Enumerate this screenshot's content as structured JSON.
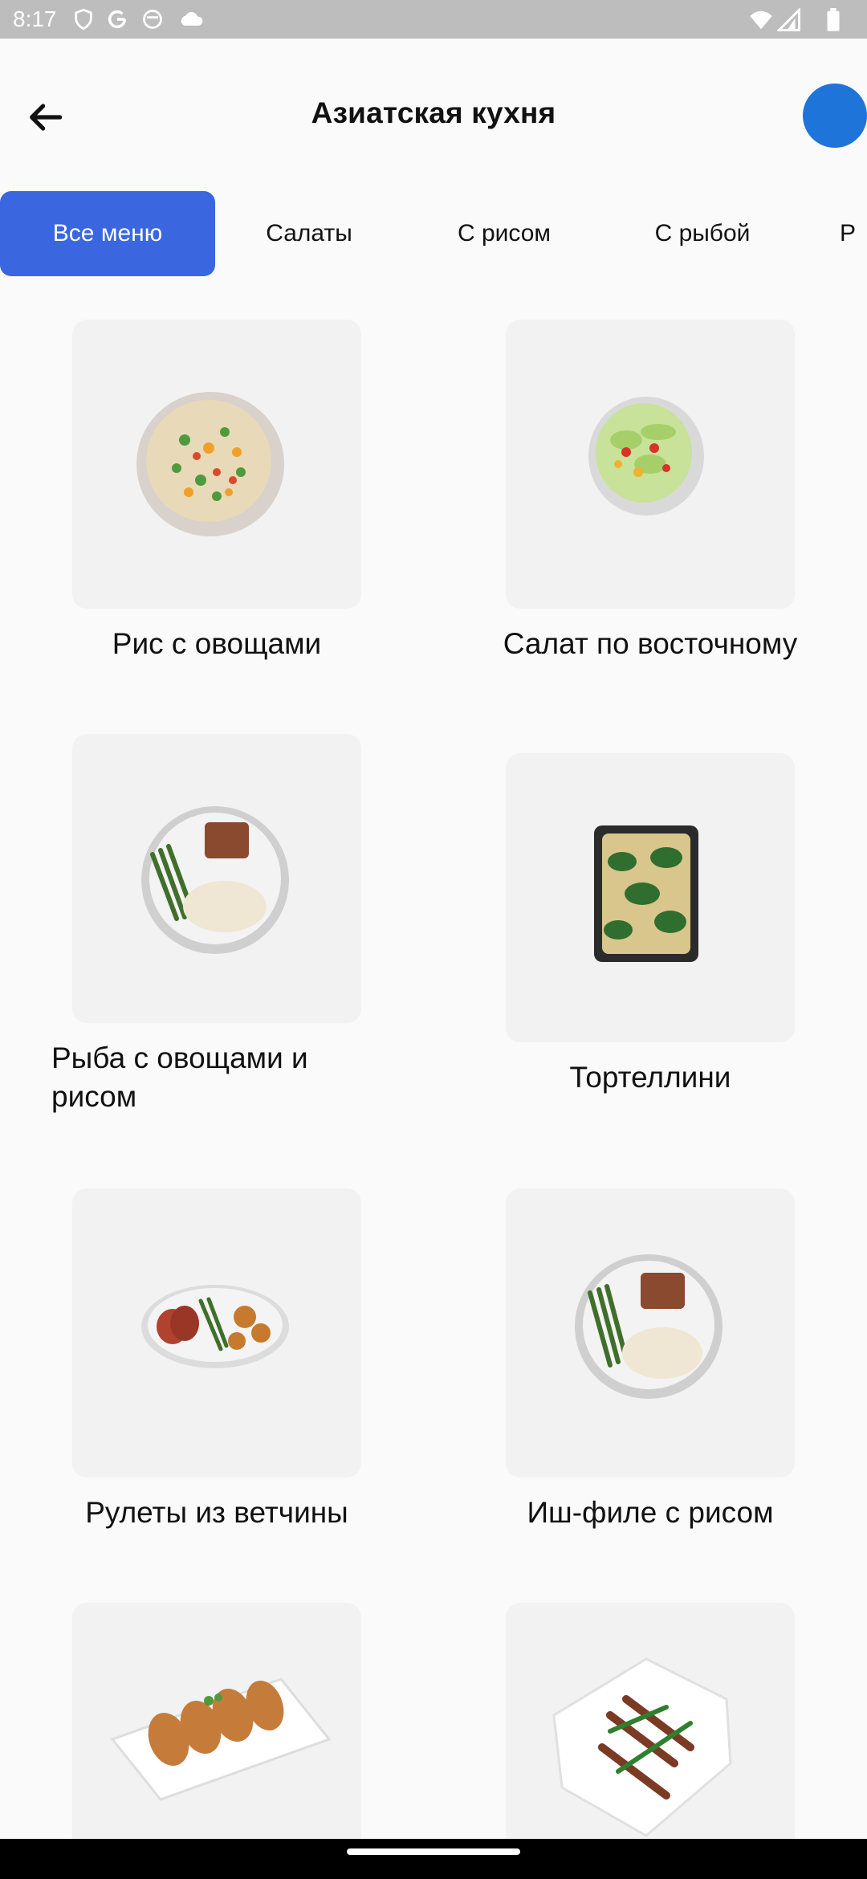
{
  "status": {
    "time": "8:17"
  },
  "header": {
    "title": "Азиатская кухня"
  },
  "tabs": [
    {
      "label": "Все меню",
      "active": true
    },
    {
      "label": "Салаты"
    },
    {
      "label": "С рисом"
    },
    {
      "label": "С рыбой"
    },
    {
      "label": "Р"
    }
  ],
  "dishes": [
    {
      "name": "Рис с овощами"
    },
    {
      "name": "Салат по восточному"
    },
    {
      "name": "Рыба с овощами и рисом"
    },
    {
      "name": "Тортеллини"
    },
    {
      "name": "Рулеты из ветчины"
    },
    {
      "name": "Иш-филе с рисом"
    }
  ],
  "colors": {
    "accent": "#3a66e0",
    "avatar": "#1e74d9",
    "statusbar": "#bdbdbd"
  }
}
